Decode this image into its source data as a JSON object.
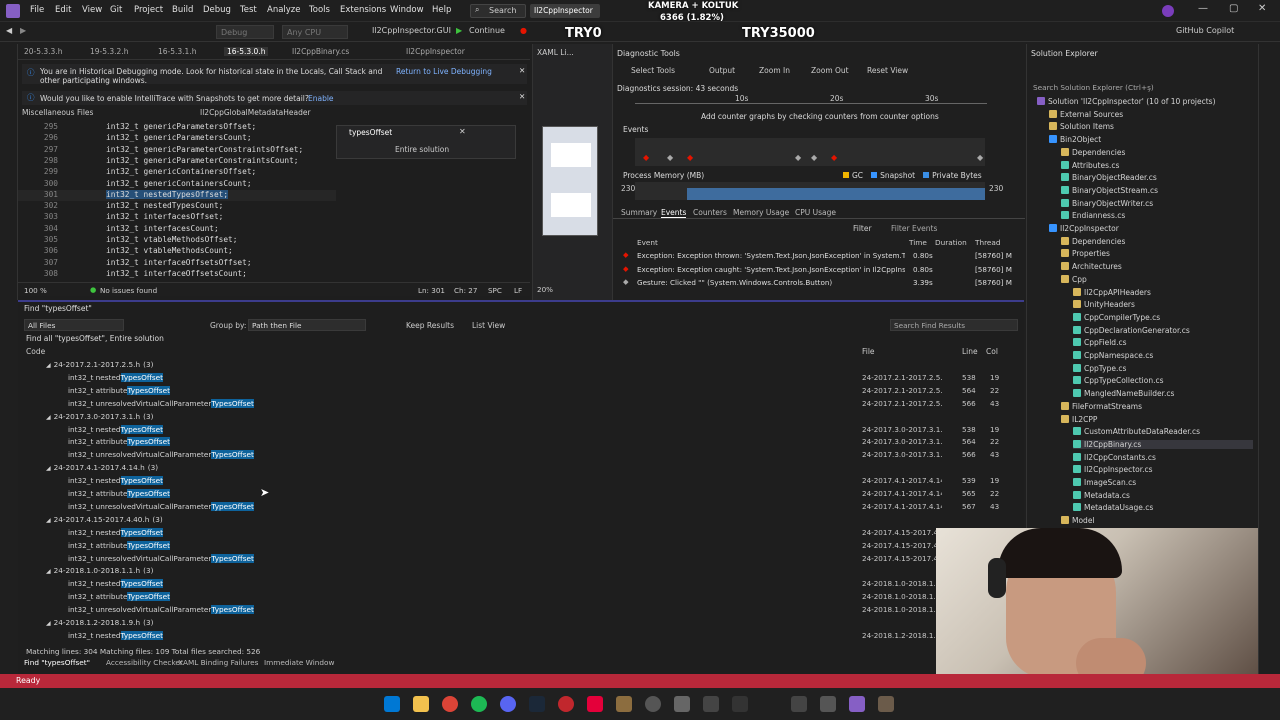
{
  "titlebar": {
    "menus": [
      "File",
      "Edit",
      "View",
      "Git",
      "Project",
      "Build",
      "Debug",
      "Test",
      "Analyze",
      "Tools",
      "Extensions",
      "Window",
      "Help"
    ],
    "search_label": "Search",
    "solution_name": "Il2CppInspector",
    "copilot": "GitHub Copilot"
  },
  "toolbar": {
    "config": "Debug",
    "platform": "Any CPU",
    "startup_project": "Il2CppInspector.GUI",
    "continue_label": "Continue"
  },
  "overlay": {
    "top_line1": "KAMERA + KOLTUK",
    "top_line2": "6366 (1.82%)",
    "left": "TRY0",
    "right": "TRY35000"
  },
  "editor": {
    "tabs": [
      "20-5.3.3.h",
      "19-5.3.2.h",
      "16-5.3.1.h",
      "16-5.3.0.h",
      "Il2CppBinary.cs",
      "Il2CppInspector"
    ],
    "info_bar_1": "You are in Historical Debugging mode. Look for historical state in the Locals, Call Stack and other participating windows.",
    "info_bar_1_link": "Return to Live Debugging",
    "info_bar_2": "Would you like to enable IntelliTrace with Snapshots to get more detail?",
    "info_bar_2_link": "Enable",
    "scope_left": "Miscellaneous Files",
    "scope_right": "Il2CppGlobalMetadataHeader",
    "find_query": "typesOffset",
    "find_scope": "Entire solution",
    "lines": [
      {
        "n": "295",
        "code": "int32_t genericParametersOffset;"
      },
      {
        "n": "296",
        "code": "int32_t genericParametersCount;"
      },
      {
        "n": "297",
        "code": "int32_t genericParameterConstraintsOffset;"
      },
      {
        "n": "298",
        "code": "int32_t genericParameterConstraintsCount;"
      },
      {
        "n": "299",
        "code": "int32_t genericContainersOffset;"
      },
      {
        "n": "300",
        "code": "int32_t genericContainersCount;"
      },
      {
        "n": "301",
        "code": "int32_t nestedTypesOffset;"
      },
      {
        "n": "302",
        "code": "int32_t nestedTypesCount;"
      },
      {
        "n": "303",
        "code": "int32_t interfacesOffset;"
      },
      {
        "n": "304",
        "code": "int32_t interfacesCount;"
      },
      {
        "n": "305",
        "code": "int32_t vtableMethodsOffset;"
      },
      {
        "n": "306",
        "code": "int32_t vtableMethodsCount;"
      },
      {
        "n": "307",
        "code": "int32_t interfaceOffsetsOffset;"
      },
      {
        "n": "308",
        "code": "int32_t interfaceOffsetsCount;"
      }
    ],
    "zoom": "100 %",
    "issues": "No issues found",
    "position": "Ln: 301",
    "column": "Ch: 27",
    "spc": "SPC",
    "lf": "LF"
  },
  "xaml": {
    "title": "XAML Li...",
    "zoom": "20%"
  },
  "diagnostics": {
    "title": "Diagnostic Tools",
    "select_tools": "Select Tools",
    "output": "Output",
    "zoom_in": "Zoom In",
    "zoom_out": "Zoom Out",
    "reset_view": "Reset View",
    "session": "Diagnostics session: 43 seconds",
    "ticks": [
      "10s",
      "20s",
      "30s"
    ],
    "hint": "Add counter graphs by checking counters from counter options",
    "events_label": "Events",
    "memory_label": "Process Memory (MB)",
    "legend": [
      "GC",
      "Snapshot",
      "Private Bytes"
    ],
    "mem_value": "230",
    "tabs": [
      "Summary",
      "Events",
      "Counters",
      "Memory Usage",
      "CPU Usage"
    ],
    "filter": "Filter",
    "filter_events": "Filter Events",
    "headers": [
      "Event",
      "Time",
      "Duration",
      "Thread"
    ],
    "rows": [
      {
        "event": "Exception: Exception thrown: 'System.Text.Json.JsonException' in System.T...",
        "time": "0.80s",
        "thread": "[58760] M"
      },
      {
        "event": "Exception: Exception caught: 'System.Text.Json.JsonException' in Il2CppIns...",
        "time": "0.80s",
        "thread": "[58760] M"
      },
      {
        "event": "Gesture: Clicked \"\" (System.Windows.Controls.Button)",
        "time": "3.39s",
        "thread": "[58760] M"
      }
    ]
  },
  "solution_explorer": {
    "title": "Solution Explorer",
    "search": "Search Solution Explorer (Ctrl+ş)",
    "items": [
      {
        "t": "Solution 'Il2CppInspector' (10 of 10 projects)",
        "lvl": 0
      },
      {
        "t": "External Sources",
        "lvl": 1
      },
      {
        "t": "Solution Items",
        "lvl": 1
      },
      {
        "t": "Bin2Object",
        "lvl": 1
      },
      {
        "t": "Dependencies",
        "lvl": 2
      },
      {
        "t": "Attributes.cs",
        "lvl": 2
      },
      {
        "t": "BinaryObjectReader.cs",
        "lvl": 2
      },
      {
        "t": "BinaryObjectStream.cs",
        "lvl": 2
      },
      {
        "t": "BinaryObjectWriter.cs",
        "lvl": 2
      },
      {
        "t": "Endianness.cs",
        "lvl": 2
      },
      {
        "t": "Il2CppInspector",
        "lvl": 1
      },
      {
        "t": "Dependencies",
        "lvl": 2
      },
      {
        "t": "Properties",
        "lvl": 2
      },
      {
        "t": "Architectures",
        "lvl": 2
      },
      {
        "t": "Cpp",
        "lvl": 2
      },
      {
        "t": "Il2CppAPIHeaders",
        "lvl": 3
      },
      {
        "t": "UnityHeaders",
        "lvl": 3
      },
      {
        "t": "CppCompilerType.cs",
        "lvl": 3
      },
      {
        "t": "CppDeclarationGenerator.cs",
        "lvl": 3
      },
      {
        "t": "CppField.cs",
        "lvl": 3
      },
      {
        "t": "CppNamespace.cs",
        "lvl": 3
      },
      {
        "t": "CppType.cs",
        "lvl": 3
      },
      {
        "t": "CppTypeCollection.cs",
        "lvl": 3
      },
      {
        "t": "MangledNameBuilder.cs",
        "lvl": 3
      },
      {
        "t": "FileFormatStreams",
        "lvl": 2
      },
      {
        "t": "IL2CPP",
        "lvl": 2
      },
      {
        "t": "CustomAttributeDataReader.cs",
        "lvl": 3
      },
      {
        "t": "Il2CppBinary.cs",
        "lvl": 3
      },
      {
        "t": "Il2CppConstants.cs",
        "lvl": 3
      },
      {
        "t": "Il2CppInspector.cs",
        "lvl": 3
      },
      {
        "t": "ImageScan.cs",
        "lvl": 3
      },
      {
        "t": "Metadata.cs",
        "lvl": 3
      },
      {
        "t": "MetadataUsage.cs",
        "lvl": 3
      },
      {
        "t": "Model",
        "lvl": 2
      }
    ]
  },
  "find_results": {
    "title": "Find \"typesOffset\"",
    "scope": "All Files",
    "group_by_label": "Group by:",
    "group_by": "Path then File",
    "keep_results": "Keep Results",
    "list_view": "List View",
    "search_placeholder": "Search Find Results",
    "summary": "Find all \"typesOffset\", Entire solution",
    "col_code": "Code",
    "col_file": "File",
    "col_line": "Line",
    "col_col": "Col",
    "groups": [
      {
        "name": "24-2017.2.1-2017.2.5.h",
        "count": "(3)",
        "file": "24-2017.2.1-2017.2.5.h",
        "rows": [
          {
            "pre": "int32_t nested",
            "hl": "TypesOffset",
            "line": "538",
            "col": "19"
          },
          {
            "pre": "int32_t attribute",
            "hl": "TypesOffset",
            "line": "564",
            "col": "22"
          },
          {
            "pre": "int32_t unresolvedVirtualCallParameter",
            "hl": "TypesOffset",
            "line": "566",
            "col": "43"
          }
        ]
      },
      {
        "name": "24-2017.3.0-2017.3.1.h",
        "count": "(3)",
        "file": "24-2017.3.0-2017.3.1.h",
        "rows": [
          {
            "pre": "int32_t nested",
            "hl": "TypesOffset",
            "line": "538",
            "col": "19"
          },
          {
            "pre": "int32_t attribute",
            "hl": "TypesOffset",
            "line": "564",
            "col": "22"
          },
          {
            "pre": "int32_t unresolvedVirtualCallParameter",
            "hl": "TypesOffset",
            "line": "566",
            "col": "43"
          }
        ]
      },
      {
        "name": "24-2017.4.1-2017.4.14.h",
        "count": "(3)",
        "file": "24-2017.4.1-2017.4.14.h",
        "rows": [
          {
            "pre": "int32_t nested",
            "hl": "TypesOffset",
            "line": "539",
            "col": "19"
          },
          {
            "pre": "int32_t attribute",
            "hl": "TypesOffset",
            "line": "565",
            "col": "22"
          },
          {
            "pre": "int32_t unresolvedVirtualCallParameter",
            "hl": "TypesOffset",
            "line": "567",
            "col": "43"
          }
        ]
      },
      {
        "name": "24-2017.4.15-2017.4.40.h",
        "count": "(3)",
        "file": "24-2017.4.15-2017.4.4",
        "rows": [
          {
            "pre": "int32_t nested",
            "hl": "TypesOffset",
            "line": "",
            "col": ""
          },
          {
            "pre": "int32_t attribute",
            "hl": "TypesOffset",
            "line": "",
            "col": ""
          },
          {
            "pre": "int32_t unresolvedVirtualCallParameter",
            "hl": "TypesOffset",
            "line": "",
            "col": ""
          }
        ]
      },
      {
        "name": "24-2018.1.0-2018.1.1.h",
        "count": "(3)",
        "file": "24-2018.1.0-2018.1.1",
        "rows": [
          {
            "pre": "int32_t nested",
            "hl": "TypesOffset",
            "line": "",
            "col": ""
          },
          {
            "pre": "int32_t attribute",
            "hl": "TypesOffset",
            "line": "",
            "col": ""
          },
          {
            "pre": "int32_t unresolvedVirtualCallParameter",
            "hl": "TypesOffset",
            "line": "",
            "col": ""
          }
        ]
      },
      {
        "name": "24-2018.1.2-2018.1.9.h",
        "count": "(3)",
        "file": "24-2018.1.2-2018.1.9",
        "rows": [
          {
            "pre": "int32_t nested",
            "hl": "TypesOffset",
            "line": "",
            "col": ""
          }
        ]
      }
    ],
    "footer": "Matching lines: 304 Matching files: 109 Total files searched: 526",
    "bottom_tabs": [
      "Find \"typesOffset\"",
      "Accessibility Checker",
      "XAML Binding Failures",
      "Immediate Window"
    ]
  },
  "status": {
    "text": "Ready"
  },
  "colors": {
    "accent": "#0e639c",
    "status": "#b8283a",
    "breakpoint": "#e51400"
  }
}
